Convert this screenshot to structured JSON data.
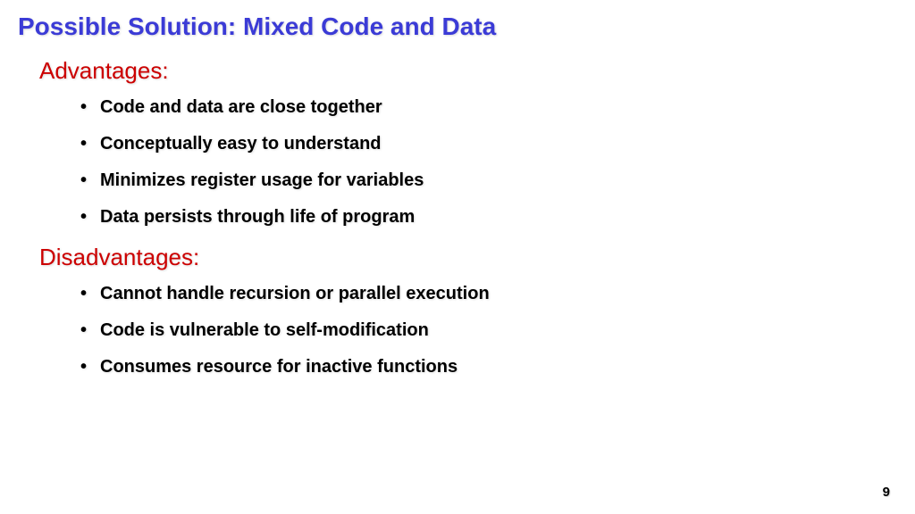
{
  "title": "Possible Solution: Mixed Code and Data",
  "sections": [
    {
      "heading": "Advantages:",
      "items": [
        "Code and data are close together",
        "Conceptually easy to understand",
        "Minimizes register usage for variables",
        "Data persists through life of program"
      ]
    },
    {
      "heading": "Disadvantages:",
      "items": [
        "Cannot handle recursion or parallel execution",
        "Code is vulnerable to self-modification",
        "Consumes resource for inactive functions"
      ]
    }
  ],
  "page_number": "9"
}
